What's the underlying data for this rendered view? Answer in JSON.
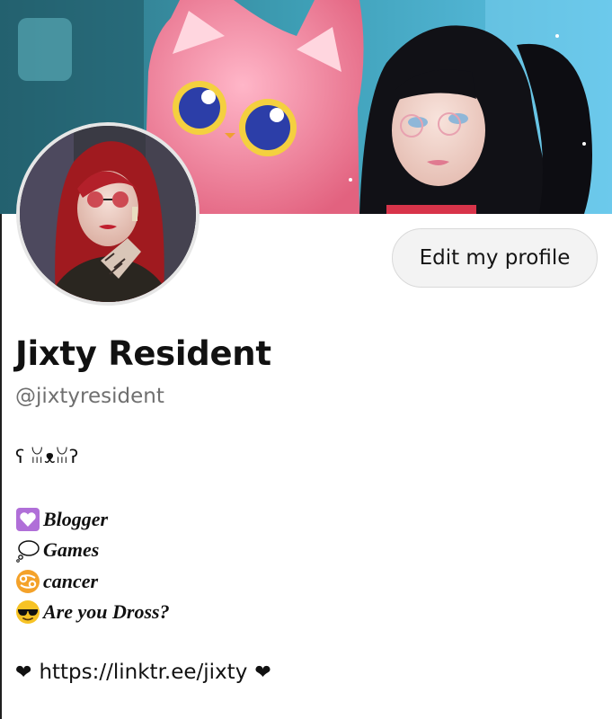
{
  "profile": {
    "edit_button_label": "Edit my profile",
    "display_name": "Jixty Resident",
    "handle": "@jixtyresident"
  },
  "bio": {
    "kaomoji": "ʕ ꈍᴥꈍʔ",
    "lines": [
      {
        "icon": "purple-heart-icon",
        "text": "Blogger"
      },
      {
        "icon": "thought-bubble-icon",
        "text": "Games"
      },
      {
        "icon": "cancer-zodiac-icon",
        "text": "cancer"
      },
      {
        "icon": "sunglasses-face-icon",
        "text": "Are you Dross?"
      }
    ],
    "link": {
      "prefix_icon": "black-heart-icon",
      "text": "https://linktr.ee/jixty",
      "suffix_icon": "black-heart-icon"
    }
  },
  "colors": {
    "banner_sky": "#3fa9d6",
    "banner_cat": "#f07a98",
    "handle_gray": "#6f6f6f",
    "button_bg": "#f3f3f3",
    "purple_heart": "#b06fd8",
    "zodiac_orange": "#f4a22a"
  }
}
